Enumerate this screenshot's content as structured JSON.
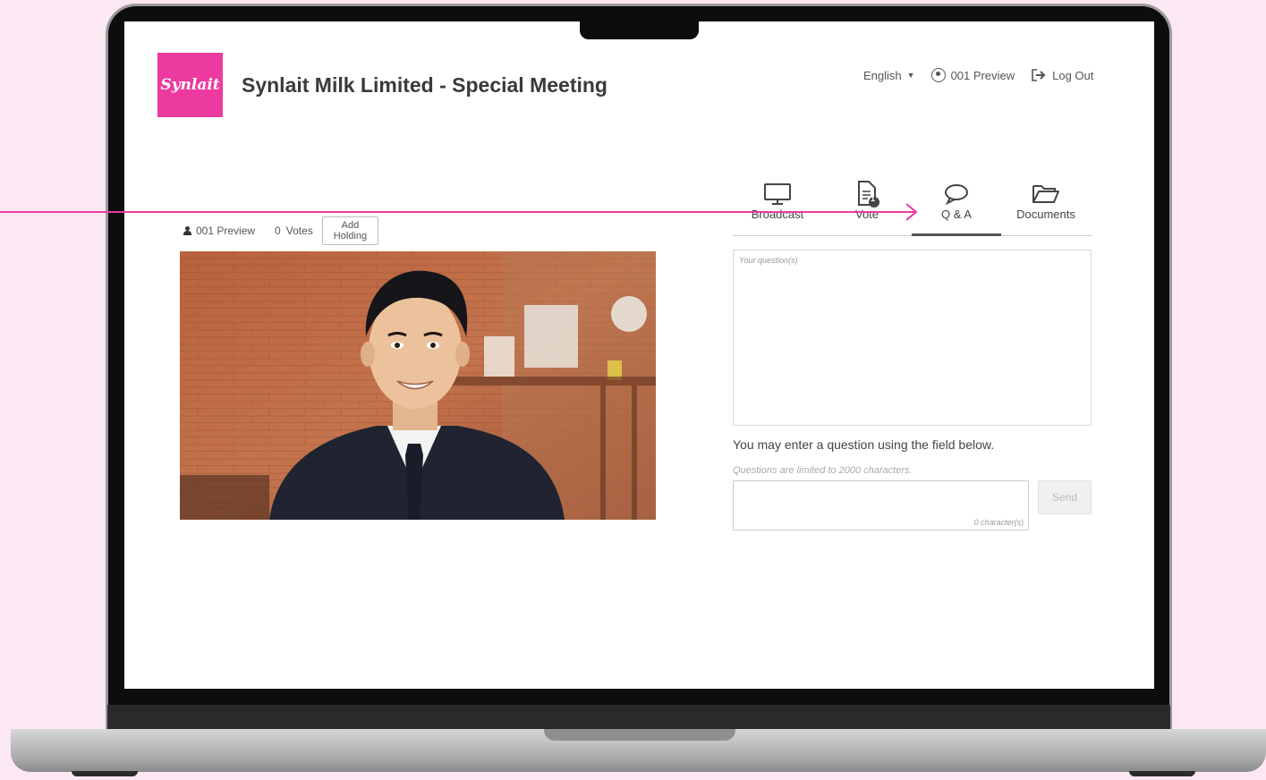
{
  "colors": {
    "brand": "#ec3aa0",
    "background": "#fce8f3",
    "annotation": "#ec3aa0"
  },
  "header": {
    "logo_text": "Synlait",
    "title": "Synlait Milk Limited - Special Meeting"
  },
  "topnav": {
    "language": "English",
    "user": "001 Preview",
    "logout": "Log Out"
  },
  "holdings": {
    "user": "001 Preview",
    "votes_count": "0",
    "votes_label": "Votes",
    "add_holding_line1": "Add",
    "add_holding_line2": "Holding"
  },
  "tabs": [
    {
      "label": "Broadcast",
      "icon": "monitor-icon",
      "active": false
    },
    {
      "label": "Vote",
      "icon": "document-icon",
      "badge": "1",
      "active": false
    },
    {
      "label": "Q & A",
      "icon": "speech-bubble-icon",
      "active": true
    },
    {
      "label": "Documents",
      "icon": "folder-icon",
      "active": false
    }
  ],
  "qa": {
    "questions_placeholder": "Your question(s)",
    "instruction": "You may enter a question using the field below.",
    "limit_note": "Questions are limited to 2000  characters.",
    "char_count": "0 character(s)",
    "send_label": "Send"
  }
}
